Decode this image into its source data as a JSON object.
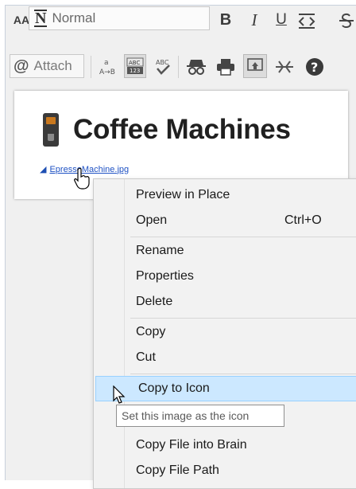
{
  "toolbar": {
    "font_size_label": "AA",
    "style_value": "Normal",
    "bold": "B",
    "italic": "I",
    "underline": "U",
    "attach_label": "Attach"
  },
  "editor": {
    "title": "Coffee Machines",
    "attachment_name": "EpressoMachine.jpg"
  },
  "context_menu": {
    "items": [
      {
        "label": "Preview in Place",
        "shortcut": ""
      },
      {
        "label": "Open",
        "shortcut": "Ctrl+O"
      },
      {
        "label": "Rename",
        "shortcut": ""
      },
      {
        "label": "Properties",
        "shortcut": ""
      },
      {
        "label": "Delete",
        "shortcut": ""
      },
      {
        "label": "Copy",
        "shortcut": ""
      },
      {
        "label": "Cut",
        "shortcut": ""
      },
      {
        "label": "Copy to Icon",
        "shortcut": ""
      },
      {
        "label": "Copy File into Brain",
        "shortcut": ""
      },
      {
        "label": "Copy File Path",
        "shortcut": ""
      }
    ],
    "highlighted_index": 7
  },
  "tooltip": {
    "text": "Set this image as the icon"
  },
  "colors": {
    "highlight": "#cce8ff",
    "link": "#1f52c4",
    "menu_bg": "#f2f2f2"
  }
}
